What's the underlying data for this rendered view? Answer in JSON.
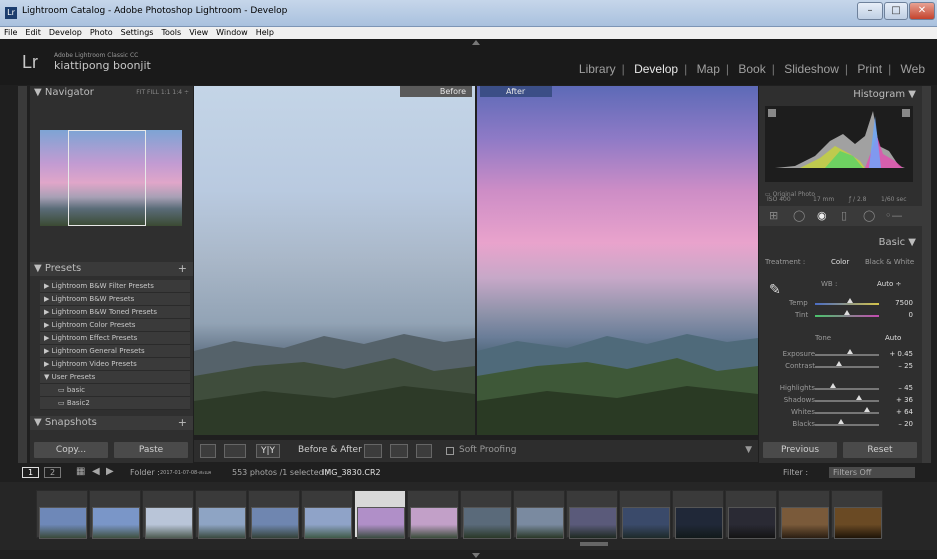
{
  "window": {
    "title": "Lightroom Catalog - Adobe Photoshop Lightroom - Develop",
    "app_icon": "Lr"
  },
  "menu": [
    "File",
    "Edit",
    "Develop",
    "Photo",
    "Settings",
    "Tools",
    "View",
    "Window",
    "Help"
  ],
  "identity": {
    "logo": "Lr",
    "subtitle": "Adobe Lightroom Classic CC",
    "name": "kiattipong boonjit"
  },
  "modules": [
    "Library",
    "Develop",
    "Map",
    "Book",
    "Slideshow",
    "Print",
    "Web"
  ],
  "left": {
    "navigator": {
      "title": "Navigator",
      "options": "FIT  FILL  1:1  1:4 ÷"
    },
    "presets": {
      "title": "Presets",
      "plus": "+",
      "items": [
        "Lightroom B&W Filter Presets",
        "Lightroom B&W Presets",
        "Lightroom B&W Toned Presets",
        "Lightroom Color Presets",
        "Lightroom Effect Presets",
        "Lightroom General Presets",
        "Lightroom Video Presets",
        "User Presets"
      ],
      "user_items": [
        "basic",
        "Basic2"
      ]
    },
    "snapshots": {
      "title": "Snapshots",
      "plus": "+"
    },
    "copy": "Copy...",
    "paste": "Paste"
  },
  "center": {
    "before_label": "Before",
    "after_label": "After",
    "toolbar": {
      "before_after": "Before & After :",
      "soft_proofing": "Soft Proofing",
      "yy": "Y|Y"
    }
  },
  "right": {
    "histogram": {
      "title": "Histogram",
      "iso": "ISO 400",
      "focal": "17 mm",
      "aperture": "ƒ / 2.8",
      "shutter": "1/60 sec",
      "original": "Original Photo"
    },
    "basic": {
      "title": "Basic",
      "treatment": "Treatment :",
      "color": "Color",
      "bw": "Black & White",
      "wb_label": "WB :",
      "wb_value": "Auto ÷",
      "temp_label": "Temp",
      "temp_value": "7500",
      "tint_label": "Tint",
      "tint_value": "0",
      "tone_label": "Tone",
      "tone_auto": "Auto",
      "sliders": [
        {
          "label": "Exposure",
          "value": "+ 0.45",
          "pos": 0.55
        },
        {
          "label": "Contrast",
          "value": "– 25",
          "pos": 0.38
        },
        {
          "label": "Highlights",
          "value": "– 45",
          "pos": 0.28
        },
        {
          "label": "Shadows",
          "value": "+ 36",
          "pos": 0.68
        },
        {
          "label": "Whites",
          "value": "+ 64",
          "pos": 0.82
        },
        {
          "label": "Blacks",
          "value": "– 20",
          "pos": 0.4
        }
      ],
      "temp_pos": 0.55,
      "tint_pos": 0.5
    },
    "previous": "Previous",
    "reset": "Reset"
  },
  "filmstrip": {
    "views": [
      "1",
      "2"
    ],
    "folder": "Folder :",
    "folder_name": "2017-01-07-08-สะแค",
    "count": "553 photos /1 selected /",
    "file": "IMG_3830.CR2",
    "filter_label": "Filter :",
    "filter_value": "Filters Off"
  }
}
